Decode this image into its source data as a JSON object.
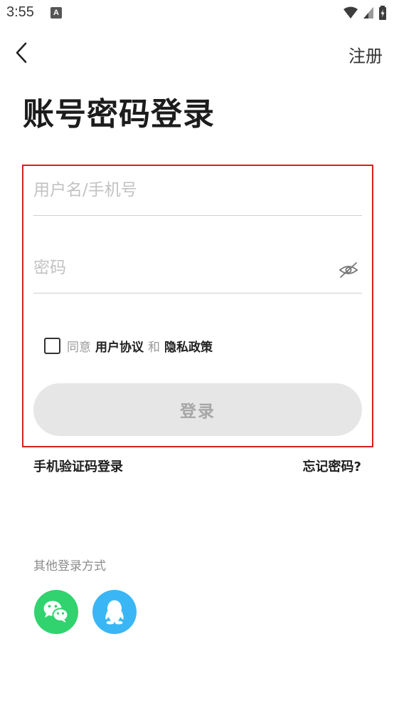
{
  "status_bar": {
    "time": "3:55",
    "notification_glyph": "A"
  },
  "header": {
    "register_label": "注册"
  },
  "title": "账号密码登录",
  "form": {
    "username_placeholder": "用户名/手机号",
    "password_placeholder": "密码",
    "agreement": {
      "agree_text": "同意",
      "terms_label": "用户协议",
      "and_text": "和",
      "privacy_label": "隐私政策",
      "checked": false
    },
    "login_label": "登录"
  },
  "links": {
    "sms_login": "手机验证码登录",
    "forgot_password": "忘记密码?"
  },
  "social": {
    "label": "其他登录方式",
    "providers": [
      {
        "icon": "wechat-icon",
        "color": "#30d36e"
      },
      {
        "icon": "qq-icon",
        "color": "#3ab6f5"
      }
    ]
  },
  "colors": {
    "highlight_border": "#d42020",
    "button_disabled": "#e6e6e6"
  }
}
